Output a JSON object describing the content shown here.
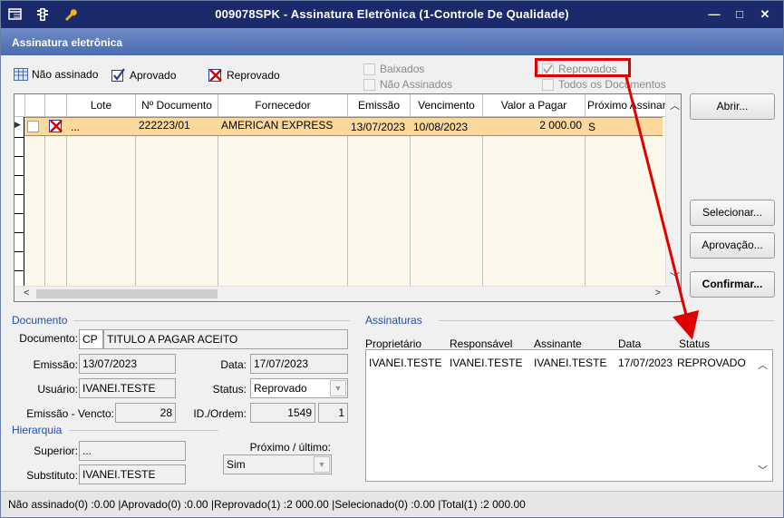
{
  "window": {
    "title": "009078SPK - Assinatura Eletrônica (1-Controle De Qualidade)",
    "controls": [
      "—",
      "□",
      "✕"
    ]
  },
  "header": {
    "title": "Assinatura eletrônica"
  },
  "legend": {
    "not_signed": "Não assinado",
    "approved": "Aprovado",
    "rejected": "Reprovado"
  },
  "filters": {
    "baixados": "Baixados",
    "nao_assinados": "Não Assinados",
    "reprovados": "Reprovados",
    "todos": "Todos os Documentos"
  },
  "grid": {
    "columns": [
      "Lote",
      "Nº Documento",
      "Fornecedor",
      "Emissão",
      "Vencimento",
      "Valor a Pagar",
      "Próximo Assinar"
    ],
    "rows": [
      {
        "lote": "...",
        "documento": "222223/01",
        "fornecedor": "AMERICAN EXPRESS",
        "emissao": "13/07/2023",
        "vencimento": "10/08/2023",
        "valor": "2 000.00",
        "proximo": "S"
      }
    ]
  },
  "buttons": {
    "abrir": "Abrir...",
    "selecionar": "Selecionar...",
    "aprovacao": "Aprovação...",
    "confirmar": "Confirmar..."
  },
  "documento": {
    "section": "Documento",
    "documento_label": "Documento:",
    "doc_code": "CP",
    "doc_desc": "TITULO A PAGAR ACEITO",
    "emissao_label": "Emissão:",
    "emissao": "13/07/2023",
    "data_label": "Data:",
    "data": "17/07/2023",
    "usuario_label": "Usuário:",
    "usuario": "IVANEI.TESTE",
    "status_label": "Status:",
    "status": "Reprovado",
    "emissao_vencto_label": "Emissão - Vencto:",
    "emissao_vencto": "28",
    "id_ordem_label": "ID./Ordem:",
    "id": "1549",
    "ordem": "1"
  },
  "hierarquia": {
    "section": "Hierarquia",
    "superior_label": "Superior:",
    "superior": "...",
    "substituto_label": "Substituto:",
    "substituto": "IVANEI.TESTE",
    "proximo_label": "Próximo / último:",
    "proximo": "Sim"
  },
  "assinaturas": {
    "section": "Assinaturas",
    "columns": [
      "Proprietário",
      "Responsável",
      "Assinante",
      "Data",
      "Status"
    ],
    "rows": [
      {
        "proprietario": "IVANEI.TESTE",
        "responsavel": "IVANEI.TESTE",
        "assinante": "IVANEI.TESTE",
        "data": "17/07/2023",
        "status": "REPROVADO"
      }
    ]
  },
  "statusbar": {
    "text": "Não assinado(0) :0.00 |Aprovado(0) :0.00 |Reprovado(1) :2 000.00 |Selecionado(0) :0.00 |Total(1) :2 000.00"
  },
  "colors": {
    "titlebar": "#1b2a6b",
    "header": "#5b7cc0",
    "selected_row": "#fbd89b",
    "annotation": "#e00000",
    "section": "#1f4fb3"
  }
}
